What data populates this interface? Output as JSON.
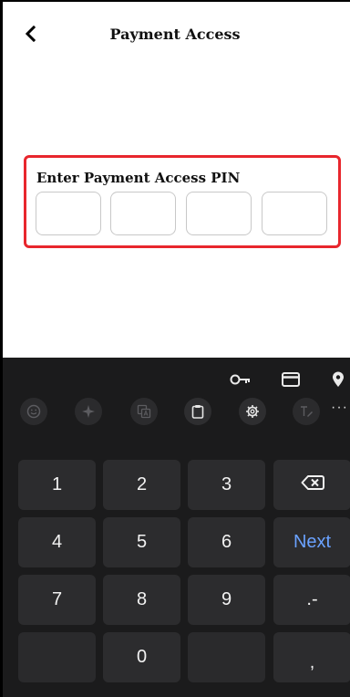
{
  "header": {
    "title": "Payment Access",
    "back_icon": "chevron-left-icon"
  },
  "pin": {
    "label": "Enter Payment Access PIN",
    "digits": [
      "",
      "",
      "",
      ""
    ],
    "highlight_color": "#e8262d"
  },
  "keyboard": {
    "top_toolbar_icons": [
      "key-icon",
      "card-icon",
      "location-pin-icon"
    ],
    "suggestion_icons": [
      "emoji-icon",
      "sparkle-icon",
      "translate-icon",
      "clipboard-icon",
      "settings-icon",
      "handwriting-icon",
      "more-icon"
    ],
    "more_label": "···",
    "keys": {
      "k1": "1",
      "k2": "2",
      "k3": "3",
      "k4": "4",
      "k5": "5",
      "k6": "6",
      "k7": "7",
      "k8": "8",
      "k9": "9",
      "k0": "0",
      "next": "Next",
      "dot_dash": ".-",
      "comma": ","
    },
    "accent_color": "#6aa2ff"
  }
}
